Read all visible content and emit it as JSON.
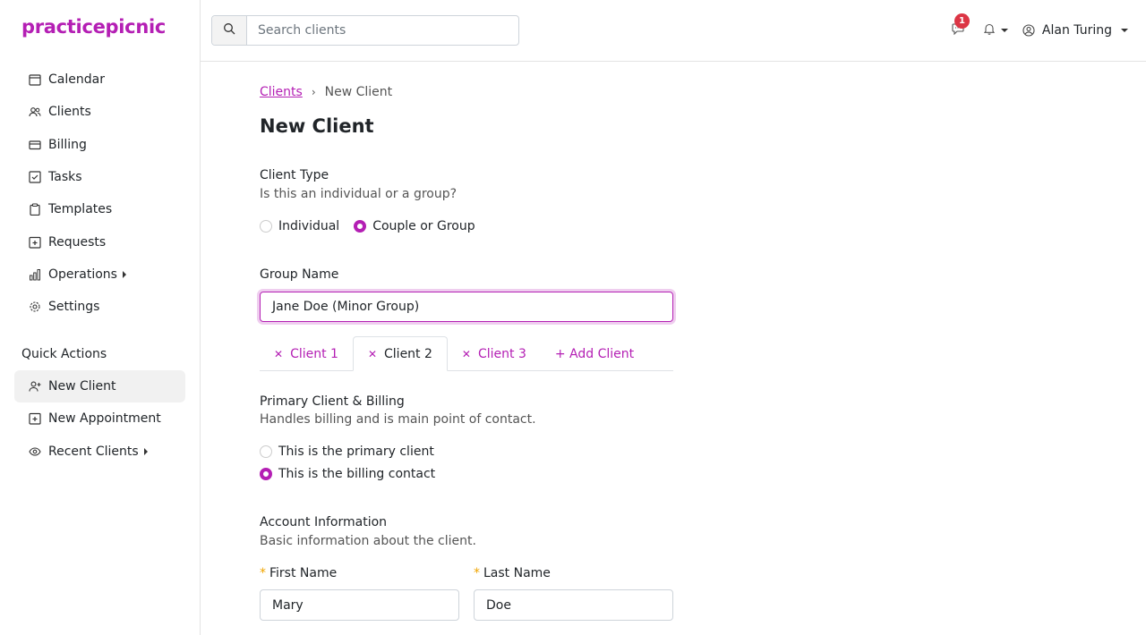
{
  "app": {
    "logo": "practicepicnic",
    "accent": "#b41fb4"
  },
  "sidebar": {
    "items": [
      {
        "label": "Calendar",
        "icon": "calendar-icon"
      },
      {
        "label": "Clients",
        "icon": "users-icon"
      },
      {
        "label": "Billing",
        "icon": "credit-card-icon"
      },
      {
        "label": "Tasks",
        "icon": "check-square-icon"
      },
      {
        "label": "Templates",
        "icon": "clipboard-icon"
      },
      {
        "label": "Requests",
        "icon": "plus-square-icon"
      },
      {
        "label": "Operations",
        "icon": "bar-chart-icon"
      },
      {
        "label": "Settings",
        "icon": "gear-icon"
      }
    ],
    "quick_actions_title": "Quick Actions",
    "quick_actions": [
      {
        "label": "New Client",
        "icon": "user-plus-icon"
      },
      {
        "label": "New Appointment",
        "icon": "calendar-plus-icon"
      },
      {
        "label": "Recent Clients",
        "icon": "eye-icon"
      }
    ]
  },
  "topbar": {
    "search_placeholder": "Search clients",
    "chat_badge": "1",
    "user_name": "Alan Turing"
  },
  "main": {
    "breadcrumb": {
      "link": "Clients",
      "current": "New Client"
    },
    "title": "New Client",
    "client_type": {
      "title": "Client Type",
      "subtitle": "Is this an individual or a group?",
      "options": [
        "Individual",
        "Couple or Group"
      ],
      "selected": "Couple or Group"
    },
    "group_name": {
      "label": "Group Name",
      "value": "Jane Doe (Minor Group)"
    },
    "tabs": [
      "Client 1",
      "Client 2",
      "Client 3"
    ],
    "add_client": "+ Add Client",
    "active_tab": "Client 2",
    "primary": {
      "title": "Primary Client & Billing",
      "subtitle": "Handles billing and is main point of contact.",
      "option_primary": "This is the primary client",
      "option_billing": "This is the billing contact"
    },
    "account": {
      "title": "Account Information",
      "subtitle": "Basic information about the client.",
      "first_name_label": "First Name",
      "first_name_value": "Mary",
      "last_name_label": "Last Name",
      "last_name_value": "Doe"
    }
  }
}
